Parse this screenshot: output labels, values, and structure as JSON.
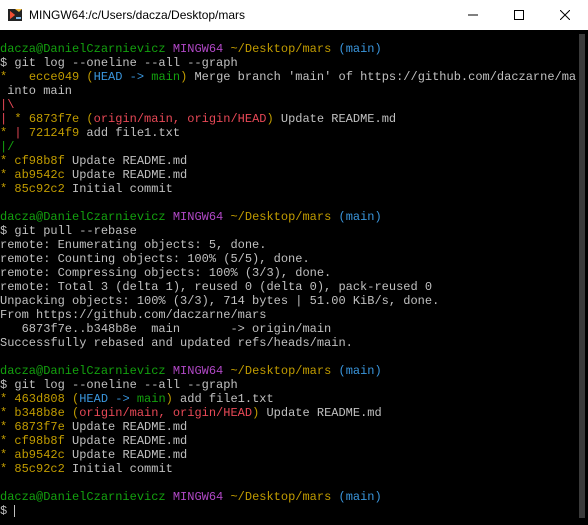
{
  "window": {
    "title": "MINGW64:/c/Users/dacza/Desktop/mars",
    "icon": "git-bash-icon",
    "controls": {
      "minimize": "minimize-icon",
      "maximize": "maximize-icon",
      "close": "close-icon"
    }
  },
  "prompt": {
    "user_host": "dacza@DanielCzarnievicz",
    "shell": "MINGW64",
    "path": "~/Desktop/mars",
    "branch": "(main)",
    "symbol": "$"
  },
  "block1": {
    "command": "git log --oneline --all --graph",
    "lines": [
      {
        "graph": "*   ",
        "hash": "ecce049",
        "refs_open": " (",
        "ref_head": "HEAD -> ",
        "ref_branch": "main",
        "refs_close": ")",
        "msg": " Merge branch 'main' of https://github.com/daczarne/mars"
      },
      {
        "graph": "",
        "hash": "",
        "msg": " into main"
      },
      {
        "graph": "|\\",
        "hash": "",
        "msg": ""
      },
      {
        "graph": "| * ",
        "hash": "6873f7e",
        "refs_open": " (",
        "ref_origin": "origin/main, origin/HEAD",
        "refs_close": ")",
        "msg": " Update README.md"
      },
      {
        "graph": "* | ",
        "hash": "72124f9",
        "msg": " add file1.txt"
      },
      {
        "graph": "|/",
        "hash": "",
        "msg": ""
      },
      {
        "graph": "* ",
        "hash": "cf98b8f",
        "msg": " Update README.md"
      },
      {
        "graph": "* ",
        "hash": "ab9542c",
        "msg": " Update README.md"
      },
      {
        "graph": "* ",
        "hash": "85c92c2",
        "msg": " Initial commit"
      }
    ]
  },
  "block2": {
    "command": "git pull --rebase",
    "output": [
      "remote: Enumerating objects: 5, done.",
      "remote: Counting objects: 100% (5/5), done.",
      "remote: Compressing objects: 100% (3/3), done.",
      "remote: Total 3 (delta 1), reused 0 (delta 0), pack-reused 0",
      "Unpacking objects: 100% (3/3), 714 bytes | 51.00 KiB/s, done.",
      "From https://github.com/daczarne/mars",
      "   6873f7e..b348b8e  main       -> origin/main",
      "Successfully rebased and updated refs/heads/main."
    ]
  },
  "block3": {
    "command": "git log --oneline --all --graph",
    "lines": [
      {
        "hash": "463d808",
        "refs": "HEAD -> main",
        "msg": " add file1.txt"
      },
      {
        "hash": "b348b8e",
        "refs": "origin/main, origin/HEAD",
        "msg": " Update README.md"
      },
      {
        "hash": "6873f7e",
        "msg": " Update README.md"
      },
      {
        "hash": "cf98b8f",
        "msg": " Update README.md"
      },
      {
        "hash": "ab9542c",
        "msg": " Update README.md"
      },
      {
        "hash": "85c92c2",
        "msg": " Initial commit"
      }
    ]
  },
  "colors": {
    "green": "#13a10e",
    "purple": "#b148c6",
    "yellow": "#c19c00",
    "cyan": "#3a96dd",
    "red": "#e74856",
    "text": "#c0c0c0",
    "background": "#000000"
  }
}
